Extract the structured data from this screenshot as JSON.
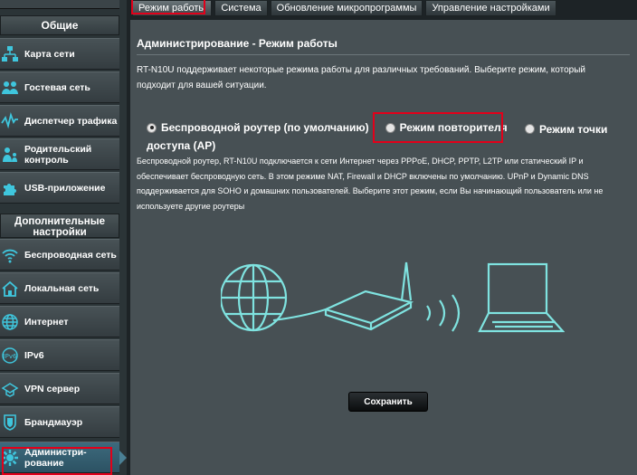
{
  "sidebar": {
    "section_general": "Общие",
    "section_advanced": "Дополнительные настройки",
    "general_items": [
      {
        "label": "Карта сети",
        "icon": "network-map-icon"
      },
      {
        "label": "Гостевая сеть",
        "icon": "guest-network-icon"
      },
      {
        "label": "Диспетчер трафика",
        "icon": "traffic-manager-icon"
      },
      {
        "label": "Родительский контроль",
        "icon": "parental-control-icon"
      },
      {
        "label": "USB-приложение",
        "icon": "usb-app-icon"
      }
    ],
    "advanced_items": [
      {
        "label": "Беспроводная сеть",
        "icon": "wireless-icon"
      },
      {
        "label": "Локальная сеть",
        "icon": "lan-icon"
      },
      {
        "label": "Интернет",
        "icon": "internet-icon"
      },
      {
        "label": "IPv6",
        "icon": "ipv6-icon"
      },
      {
        "label": "VPN сервер",
        "icon": "vpn-icon"
      },
      {
        "label": "Брандмауэр",
        "icon": "firewall-icon"
      },
      {
        "label": "Администри-рование",
        "icon": "administration-icon"
      }
    ]
  },
  "tabs": [
    {
      "label": "Режим работы",
      "active": true
    },
    {
      "label": "Система",
      "active": false
    },
    {
      "label": "Обновление микропрограммы",
      "active": false
    },
    {
      "label": "Управление настройками",
      "active": false
    }
  ],
  "main": {
    "title": "Администрирование - Режим работы",
    "intro": "RT-N10U поддерживает некоторые режима работы для различных требований. Выберите режим, который подходит для вашей ситуации.",
    "modes": [
      {
        "label": "Беспроводной роутер (по умолчанию)",
        "checked": true
      },
      {
        "label": "Режим повторителя",
        "checked": false
      },
      {
        "label": "Режим точки доступа (AP)",
        "checked": false
      }
    ],
    "description": "Беспроводной роутер, RT-N10U подключается к сети Интернет через PPPoE, DHCP, PPTP, L2TP или статический IP и обеспечивает беспроводную сеть. В этом режиме NAT, Firewall и DHCP включены по умолчанию. UPnP и Dynamic DNS поддерживается для SOHO и домашних пользователей. Выберите этот режим, если Вы начинающий пользователь или не используете другие роутеры",
    "save_label": "Сохранить"
  },
  "colors": {
    "accent_red": "#e2001a",
    "illustration_cyan": "#7fe3e0",
    "panel_bg": "#475054"
  }
}
